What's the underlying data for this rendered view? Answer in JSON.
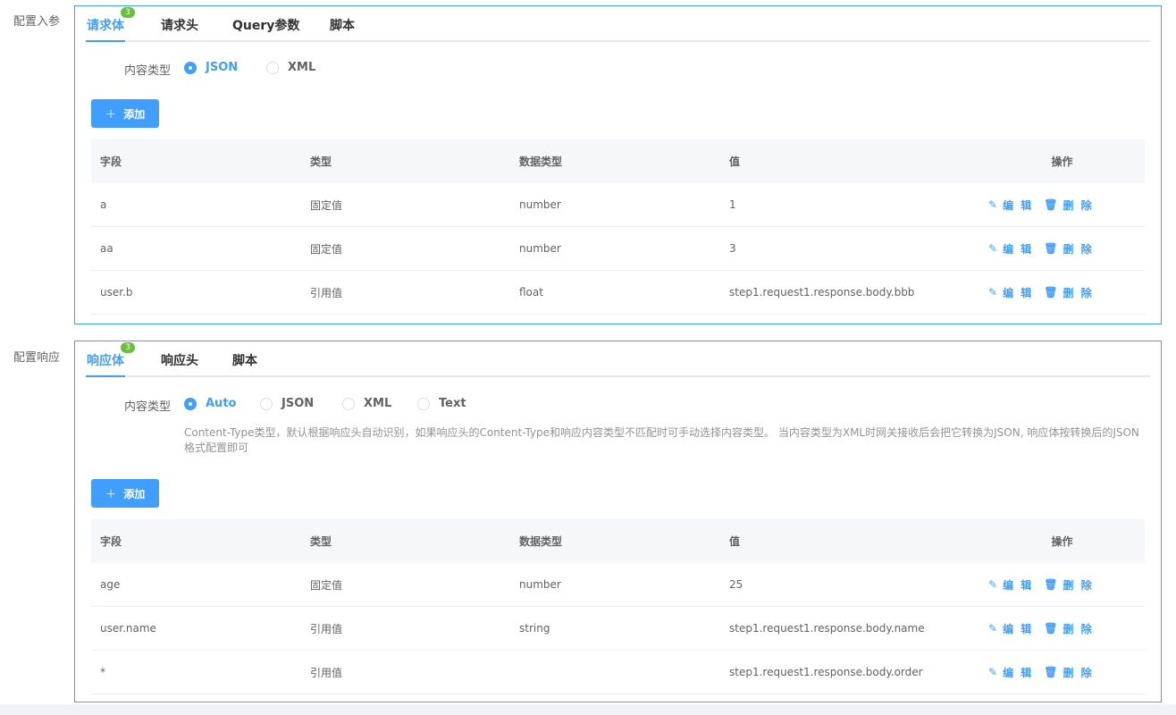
{
  "request": {
    "section_label": "配置入参",
    "tabs": [
      {
        "label": "请求体",
        "badge": "3"
      },
      {
        "label": "请求头"
      },
      {
        "label": "Query参数"
      },
      {
        "label": "脚本"
      }
    ],
    "content_type_label": "内容类型",
    "content_types": [
      "JSON",
      "XML"
    ],
    "selected_content_type": "JSON",
    "add_button": "添加",
    "columns": [
      "字段",
      "类型",
      "数据类型",
      "值",
      "操作"
    ],
    "rows": [
      {
        "field": "a",
        "type": "固定值",
        "data_type": "number",
        "value": "1"
      },
      {
        "field": "aa",
        "type": "固定值",
        "data_type": "number",
        "value": "3"
      },
      {
        "field": "user.b",
        "type": "引用值",
        "data_type": "float",
        "value": "step1.request1.response.body.bbb"
      }
    ]
  },
  "response": {
    "section_label": "配置响应",
    "tabs": [
      {
        "label": "响应体",
        "badge": "3"
      },
      {
        "label": "响应头"
      },
      {
        "label": "脚本"
      }
    ],
    "content_type_label": "内容类型",
    "content_types": [
      "Auto",
      "JSON",
      "XML",
      "Text"
    ],
    "selected_content_type": "Auto",
    "hint": "Content-Type类型，默认根据响应头自动识别，如果响应头的Content-Type和响应内容类型不匹配时可手动选择内容类型。 当内容类型为XML时网关接收后会把它转换为JSON, 响应体按转换后的JSON格式配置即可",
    "add_button": "添加",
    "columns": [
      "字段",
      "类型",
      "数据类型",
      "值",
      "操作"
    ],
    "rows": [
      {
        "field": "age",
        "type": "固定值",
        "data_type": "number",
        "value": "25"
      },
      {
        "field": "user.name",
        "type": "引用值",
        "data_type": "string",
        "value": "step1.request1.response.body.name"
      },
      {
        "field": "*",
        "type": "引用值",
        "data_type": "",
        "value": "step1.request1.response.body.order"
      }
    ]
  },
  "actions": {
    "edit": "编 辑",
    "delete": "删 除",
    "edit_icon": "edit-icon",
    "delete_icon": "trash-icon"
  },
  "colors": {
    "primary": "#409eff",
    "badge": "#67c23a",
    "text": "#606266",
    "header_bg": "#f5f7fa"
  }
}
